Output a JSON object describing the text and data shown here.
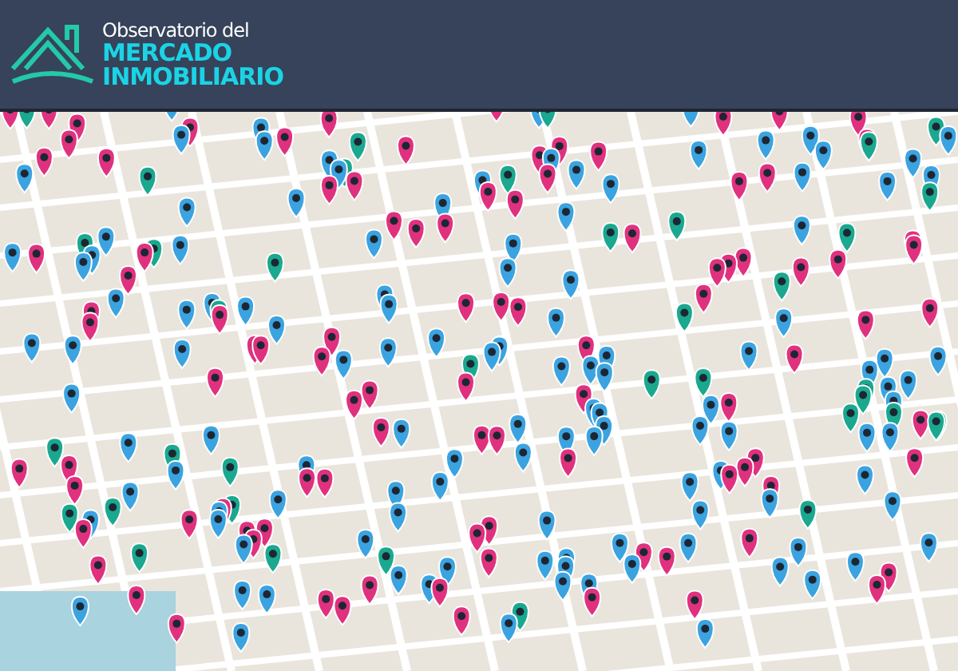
{
  "header": {
    "logo_line_1": "Observatorio del",
    "logo_line_2": "MERCADO",
    "logo_line_3": "INMOBILIARIO"
  }
}
